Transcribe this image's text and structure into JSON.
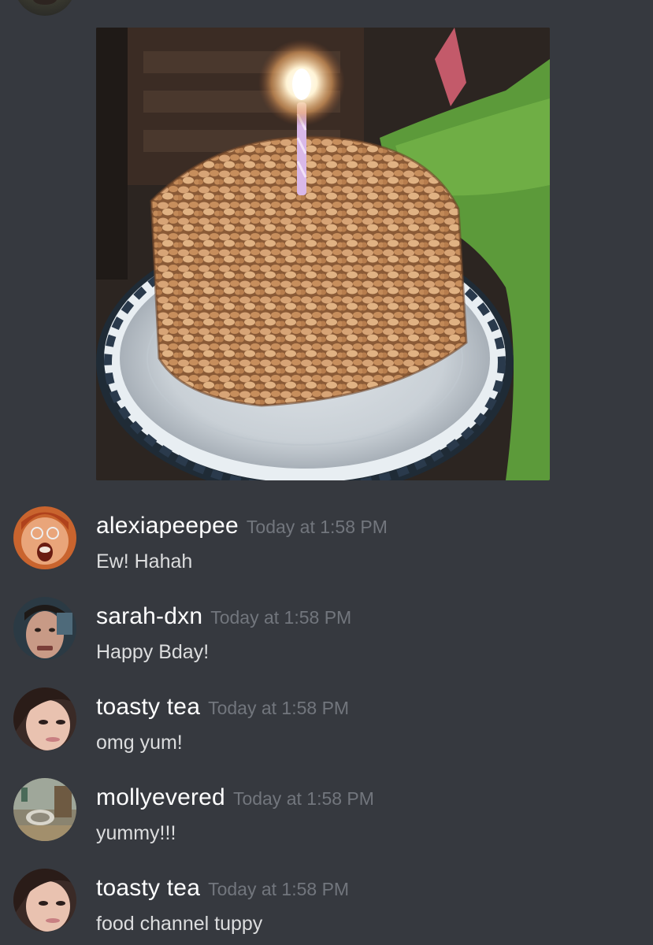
{
  "colors": {
    "background": "#36393f",
    "username": "#ffffff",
    "timestamp": "#72767d",
    "message_text": "#dcddde"
  },
  "attachment": {
    "kind": "photo",
    "subject": "bean-covered birthday cake with a lit candle on a plate"
  },
  "messages": [
    {
      "username": "alexiapeepee",
      "timestamp": "Today at 1:58 PM",
      "text": "Ew! Hahah",
      "avatar_icon": "screaming-face-avatar"
    },
    {
      "username": "sarah-dxn",
      "timestamp": "Today at 1:58 PM",
      "text": "Happy Bday!",
      "avatar_icon": "man-face-avatar"
    },
    {
      "username": "toasty tea",
      "timestamp": "Today at 1:58 PM",
      "text": "omg yum!",
      "avatar_icon": "woman-face-avatar"
    },
    {
      "username": "mollyevered",
      "timestamp": "Today at 1:58 PM",
      "text": "yummy!!!",
      "avatar_icon": "bathroom-photo-avatar"
    },
    {
      "username": "toasty tea",
      "timestamp": "Today at 1:58 PM",
      "text": "food channel tuppy",
      "avatar_icon": "woman-face-avatar"
    }
  ]
}
